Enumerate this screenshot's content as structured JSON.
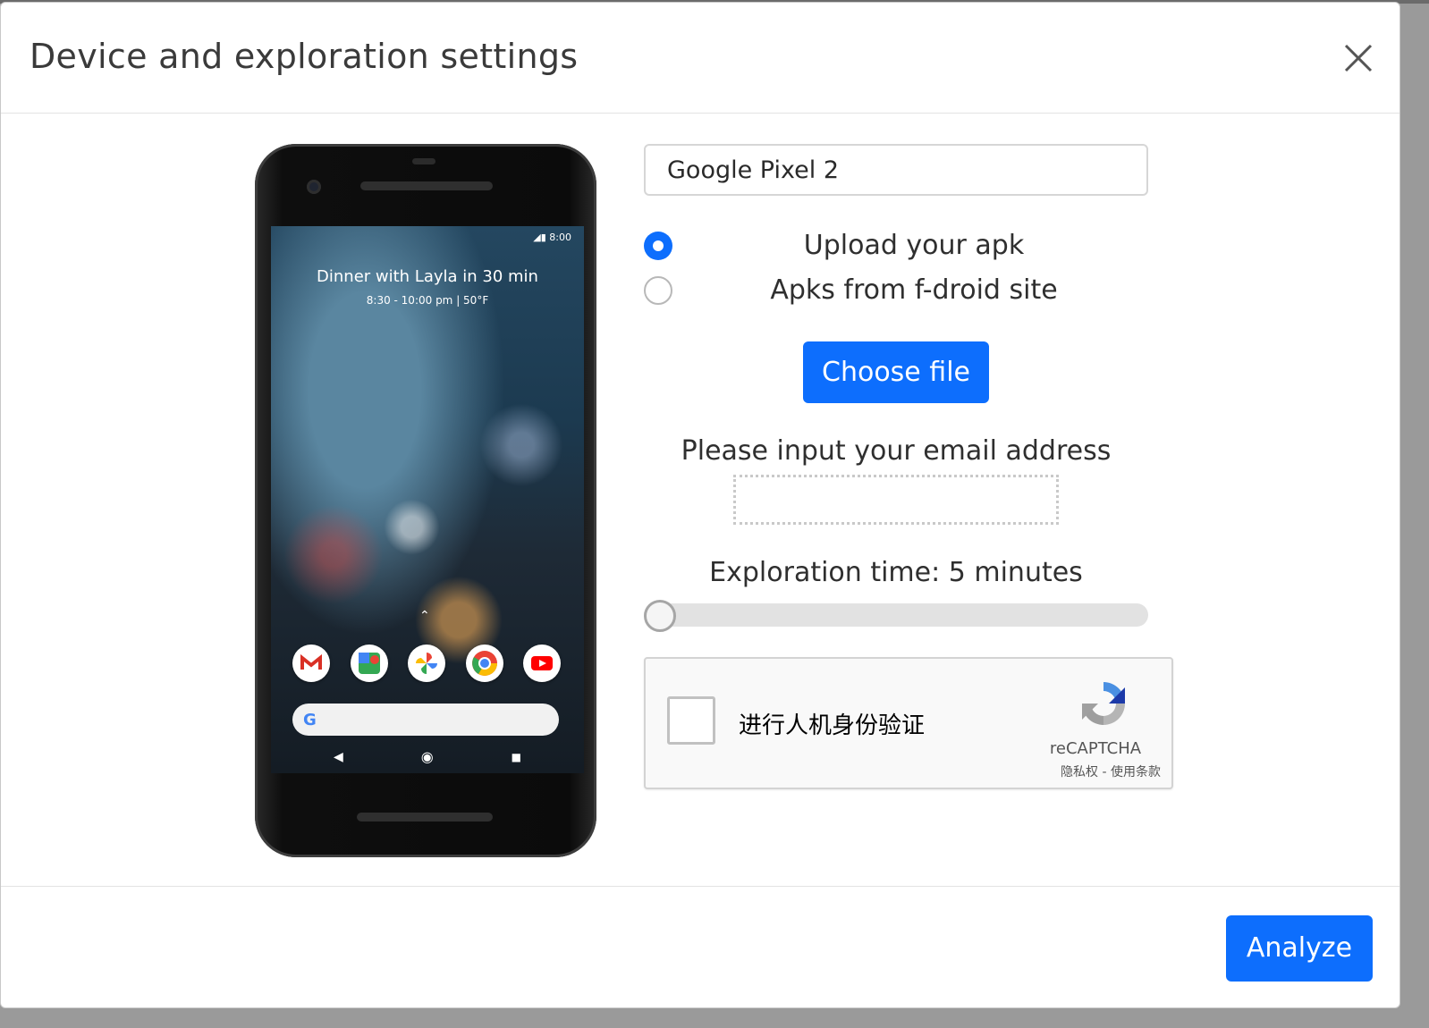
{
  "modal": {
    "title": "Device and exploration settings"
  },
  "phone": {
    "status_time": "8:00",
    "glance_title": "Dinner with Layla in 30 min",
    "glance_sub": "8:30 - 10:00 pm  |  50°F",
    "apps": [
      "gmail-icon",
      "maps-icon",
      "photos-icon",
      "chrome-icon",
      "youtube-icon"
    ],
    "search_g": "G"
  },
  "form": {
    "device_selected": "Google Pixel 2",
    "source_options": [
      {
        "label": "Upload your apk",
        "checked": true
      },
      {
        "label": "Apks from f-droid site",
        "checked": false
      }
    ],
    "choose_file_label": "Choose file",
    "email_label": "Please input your email address",
    "email_value": "",
    "time_label": "Exploration time: 5 minutes",
    "time_slider_position": 0
  },
  "recaptcha": {
    "checkbox_label": "进行人机身份验证",
    "brand": "reCAPTCHA",
    "terms": "隐私权 - 使用条款"
  },
  "footer": {
    "analyze_label": "Analyze"
  },
  "colors": {
    "primary": "#0d6efd"
  }
}
